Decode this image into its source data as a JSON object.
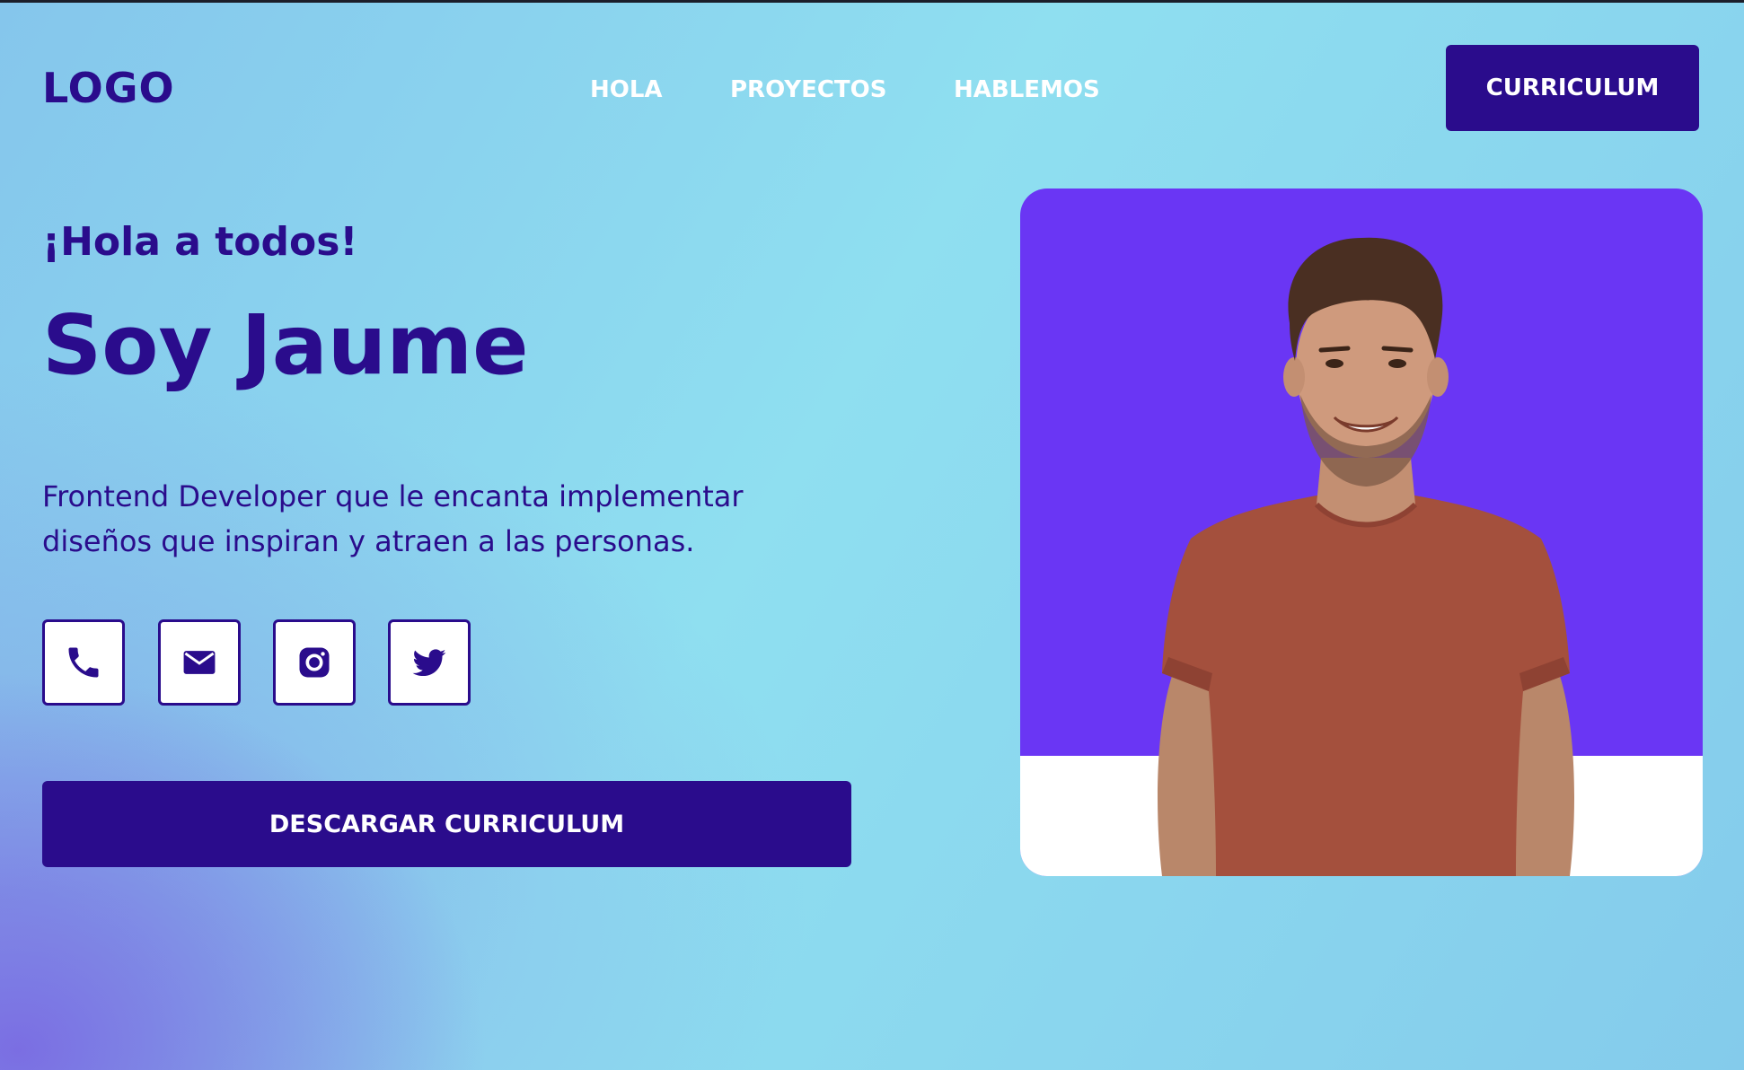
{
  "header": {
    "logo": "LOGO",
    "nav": [
      "HOLA",
      "PROYECTOS",
      "HABLEMOS"
    ],
    "cv_button": "CURRICULUM"
  },
  "hero": {
    "greeting": "¡Hola a todos!",
    "name": "Soy Jaume",
    "description_line1": "Frontend Developer que le encanta implementar",
    "description_line2": "diseños que inspiran y atraen a las personas.",
    "social_icons": [
      "phone-icon",
      "mail-icon",
      "instagram-icon",
      "twitter-icon"
    ],
    "download_button": "DESCARGAR CURRICULUM"
  },
  "colors": {
    "primary": "#2a0c8c",
    "photo_background": "#6a36f4",
    "background_light": "#8fdff0",
    "background_accent": "#7a6ae2",
    "nav_text": "#ffffff"
  }
}
